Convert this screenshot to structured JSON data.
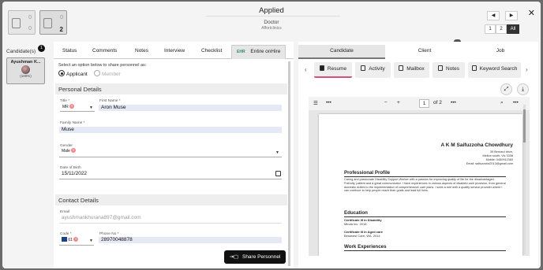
{
  "header": {
    "title": "Applied",
    "subtitle": "Doctor",
    "company": "Affortclinics",
    "tiles": [
      {
        "top": "0",
        "bottom": "0"
      },
      {
        "top": "0",
        "bottom": "2"
      }
    ],
    "nav": {
      "prev": "◀",
      "next": "▶"
    },
    "segments": [
      "1",
      "2",
      "All"
    ]
  },
  "candidates": {
    "label": "Candidate(s)",
    "count": "1",
    "items": [
      {
        "name": "Ayushman K...",
        "percent": "(100%)"
      }
    ]
  },
  "left_tabs": [
    "Status",
    "Comments",
    "Notes",
    "Interview",
    "Checklist"
  ],
  "entire_tab": {
    "logo": "EHR",
    "label": "Entire onHire"
  },
  "share": {
    "hint": "Select an option below to share personnel as:",
    "options": [
      "Applicant",
      "Member"
    ],
    "button": "Share Personnel"
  },
  "personal": {
    "section_title": "Personal Details",
    "title_label": "Title *",
    "title_value": "MR",
    "first_name_label": "First Name *",
    "first_name_value": "Aron Muse",
    "family_name_label": "Family Name *",
    "family_name_value": "Muse",
    "gender_label": "Gender",
    "gender_value": "Male",
    "dob_label": "Date of Birth",
    "dob_value": "15/11/2022"
  },
  "contact": {
    "section_title": "Contact Details",
    "email_label": "Email",
    "email_value": "ayushmankhurana897@gmail.com",
    "code_label": "Code *",
    "code_value": "61",
    "phone_label": "Phone No *",
    "phone_value": "28970048878"
  },
  "right_tabs": [
    "Candidate",
    "Client",
    "Job"
  ],
  "sub_tabs": [
    "Resume",
    "Activity",
    "Mailbox",
    "Notes",
    "Keyword Search"
  ],
  "pdf": {
    "page": "1",
    "of": "of 2",
    "minus": "−",
    "plus": "+",
    "dots": "•••"
  },
  "resume": {
    "name": "A K M Saifuzzoha Chowdhury",
    "address": [
      "39 Bernard drive,",
      "Melton south, Vic 3338",
      "Mobile: 0450912360",
      "Email: saifuzzoha2013@gmail.com"
    ],
    "profile_heading": "Professional Profile",
    "profile_text": "Caring and passionate Disability Support Worker with a passion for improving quality of life for the disadvantaged. Friendly, patient and a great communicator. I have experiences in various aspects of disabled care provision, from general domestic duties to the implementation of comprehensive care plans. I seek a role with a quality service provider where I can continue to help people reach their goals and lead full lives.",
    "education_heading": "Education",
    "edu": [
      {
        "title": "Certificate III in Disability",
        "sub": "Minda Inc. 2018"
      },
      {
        "title": "Certificate III in Aged care",
        "sub": "Bestwest Care, WA. 2014"
      }
    ],
    "work_heading": "Work Experiences"
  }
}
